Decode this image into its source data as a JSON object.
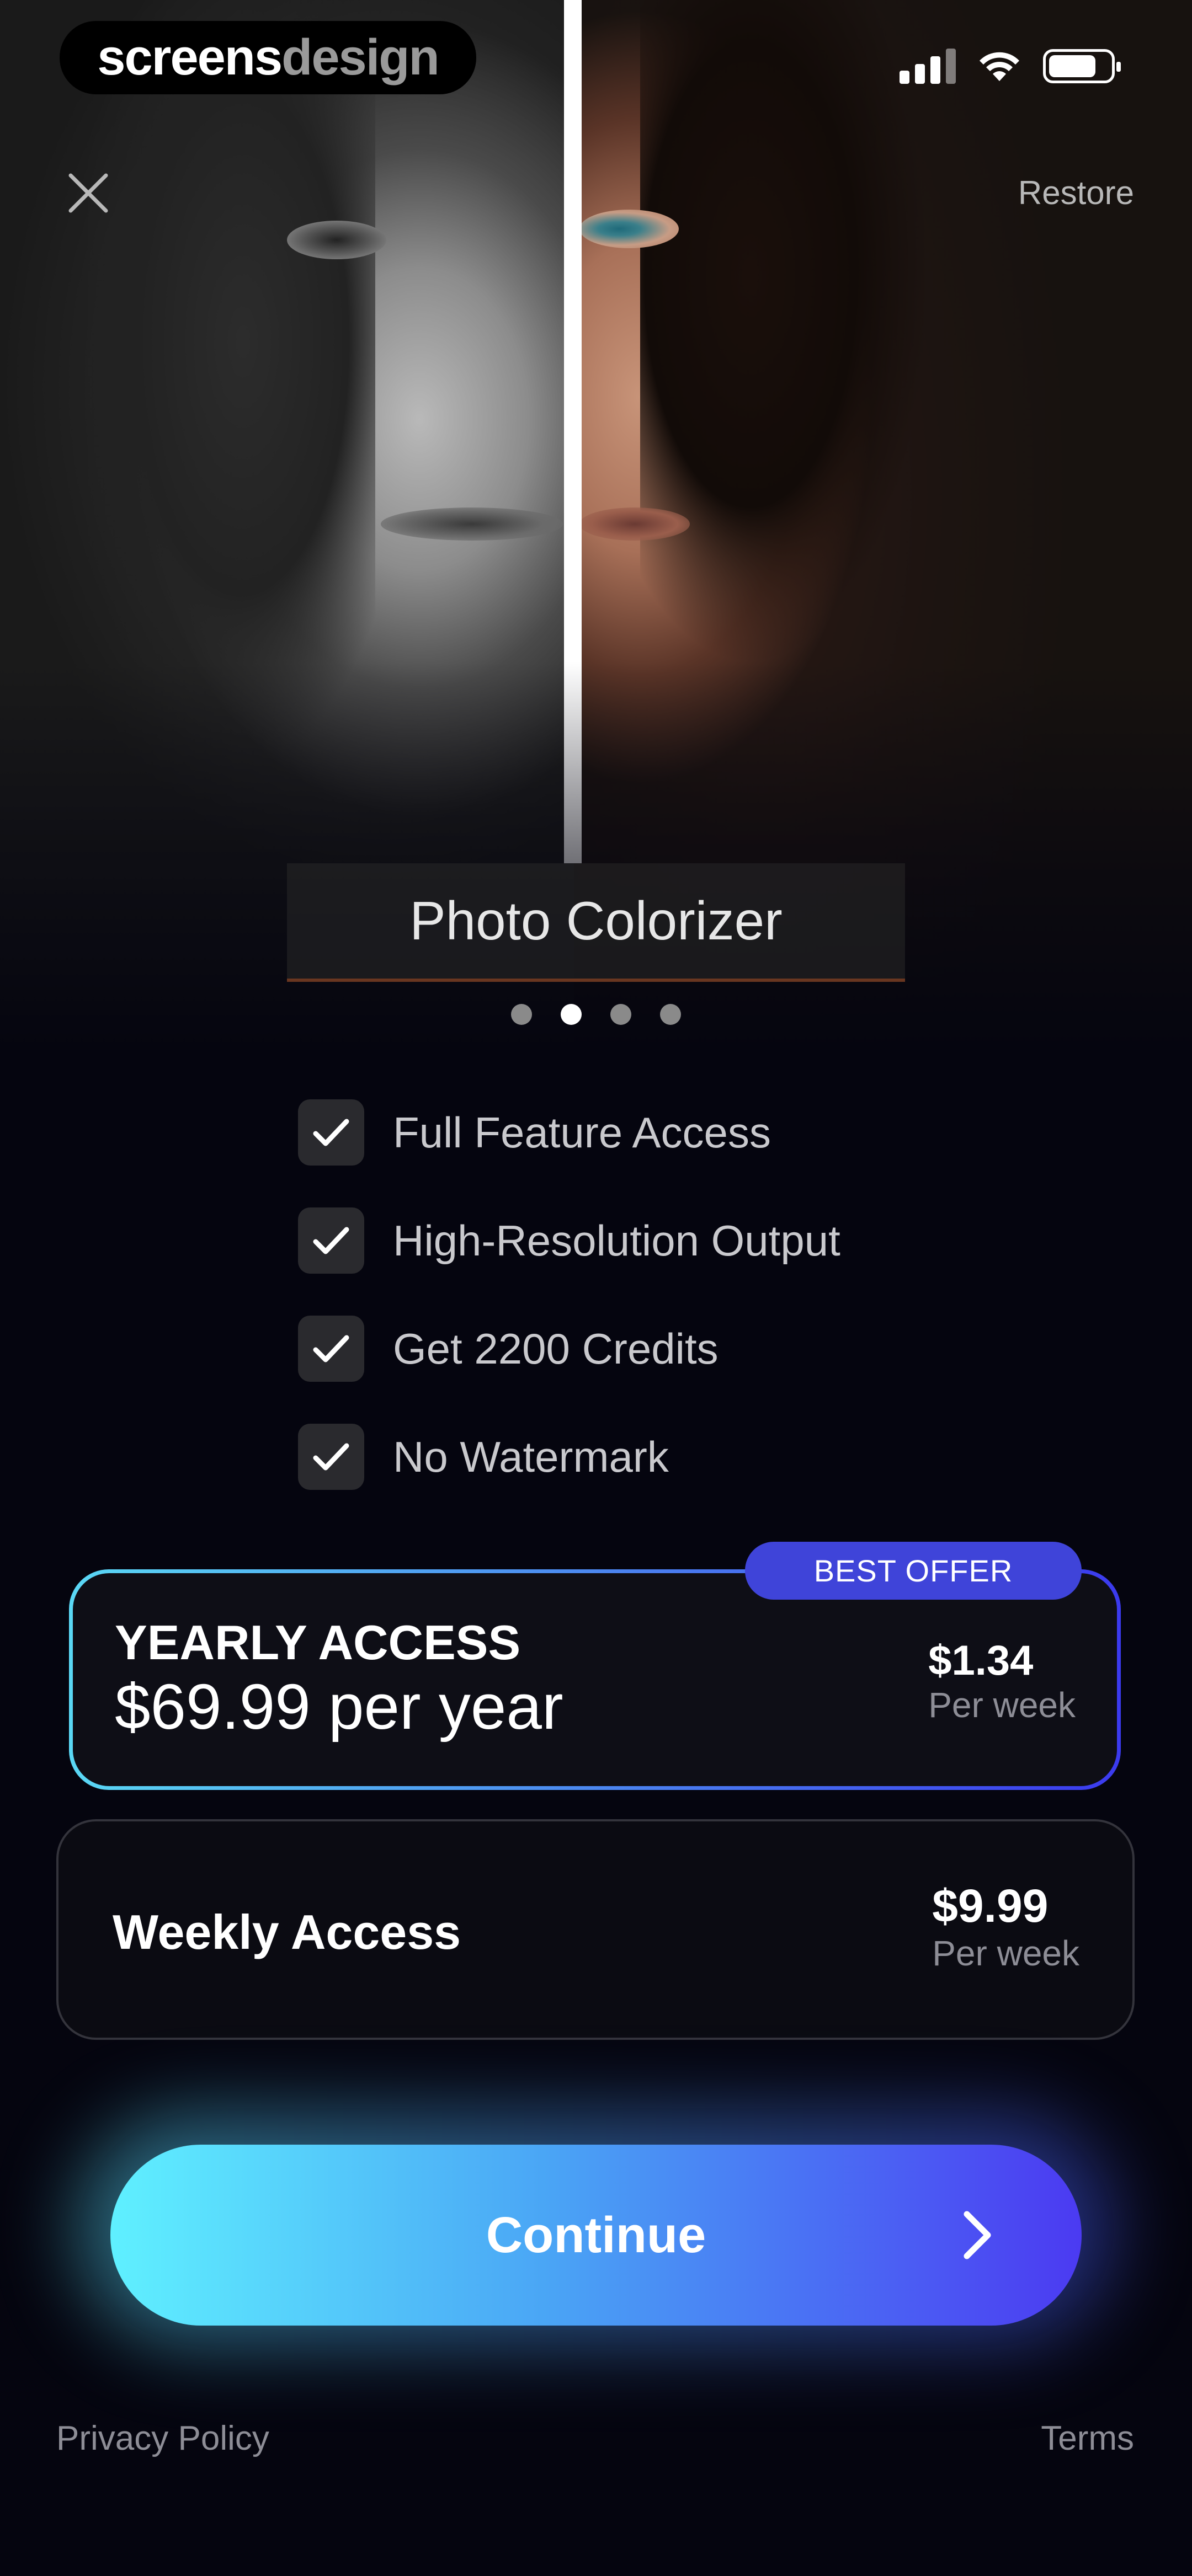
{
  "brand": {
    "part_a": "screens",
    "part_b": "design"
  },
  "top_bar": {
    "restore_label": "Restore"
  },
  "hero": {
    "title": "Photo Colorizer",
    "page_count": 4,
    "active_page": 2
  },
  "features": [
    {
      "label": "Full Feature Access",
      "icon": "check-icon"
    },
    {
      "label": "High-Resolution Output",
      "icon": "check-icon"
    },
    {
      "label": "Get 2200 Credits",
      "icon": "check-icon"
    },
    {
      "label": "No Watermark",
      "icon": "check-icon"
    }
  ],
  "plans": {
    "yearly": {
      "badge": "BEST OFFER",
      "name": "YEARLY ACCESS",
      "price": "$69.99 per year",
      "per_week_amount": "$1.34",
      "per_week_label": "Per week",
      "selected": true
    },
    "weekly": {
      "name": "Weekly Access",
      "per_week_amount": "$9.99",
      "per_week_label": "Per week",
      "selected": false
    }
  },
  "cta": {
    "label": "Continue"
  },
  "footer": {
    "privacy_label": "Privacy Policy",
    "terms_label": "Terms"
  },
  "colors": {
    "background": "#05050f",
    "badge": "#3f44d9",
    "gradient_start": "#5ff0ff",
    "gradient_end": "#4b3af2"
  }
}
